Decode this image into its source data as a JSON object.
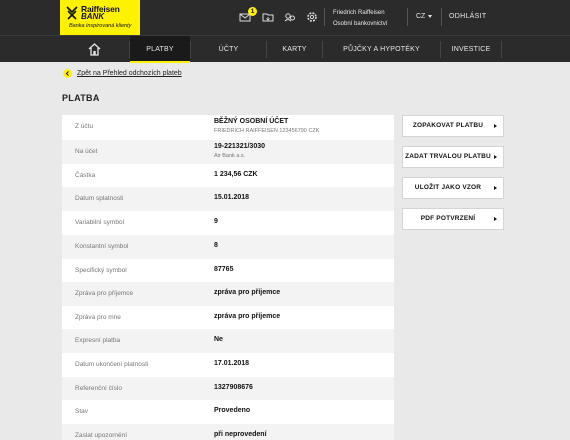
{
  "brand": {
    "name_line1": "Raiffeisen",
    "name_line2": "BANK",
    "tagline": "Banka inspirovaná klienty"
  },
  "header": {
    "notification_count": "1",
    "user_name": "Friedrich Raiffeisen",
    "user_role": "Osobní bankovnictví",
    "language": "CZ",
    "logout": "ODHLÁSIT"
  },
  "nav": {
    "items": [
      {
        "label": "PLATBY",
        "active": true
      },
      {
        "label": "ÚČTY"
      },
      {
        "label": "KARTY"
      },
      {
        "label": "PŮJČKY A HYPOTÉKY"
      },
      {
        "label": "INVESTICE"
      }
    ]
  },
  "back_link": "Zpět na Přehled odchozích plateb",
  "page_title": "PLATBA",
  "details": {
    "from_account": {
      "label": "Z účtu",
      "value": "BĚŽNÝ OSOBNÍ ÚČET",
      "sub": "FRIEDRICH RAIFFEISEN 123456790 CZK"
    },
    "to_account": {
      "label": "Na účet",
      "value": "19-221321/3030",
      "sub": "Air Bank a.s."
    },
    "amount": {
      "label": "Částka",
      "value": "1 234,56 CZK"
    },
    "due_date": {
      "label": "Datum splatnosti",
      "value": "15.01.2018"
    },
    "variable_symbol": {
      "label": "Variabilní symbol",
      "value": "9"
    },
    "constant_symbol": {
      "label": "Konstantní symbol",
      "value": "8"
    },
    "specific_symbol": {
      "label": "Specifický symbol",
      "value": "87765"
    },
    "message_recipient": {
      "label": "Zpráva pro příjemce",
      "value": "zpráva pro příjemce"
    },
    "message_me": {
      "label": "Zpráva pro mne",
      "value": "zpráva pro příjemce"
    },
    "express": {
      "label": "Expresní platba",
      "value": "Ne"
    },
    "end_date": {
      "label": "Datum ukončení platnosti",
      "value": "17.01.2018"
    },
    "reference": {
      "label": "Referenční číslo",
      "value": "1327908676"
    },
    "status": {
      "label": "Stav",
      "value": "Provedeno"
    },
    "notification": {
      "label": "Zaslat upozornění",
      "value": "při neprovedení"
    }
  },
  "actions": {
    "repeat": "ZOPAKOVAT PLATBU",
    "standing_order": "ZADAT TRVALOU PLATBU",
    "save_template": "ULOŽIT JAKO VZOR",
    "pdf": "PDF POTVRZENÍ"
  },
  "colors": {
    "brand_yellow": "#fff200",
    "header_bg": "#2b2b2b",
    "page_bg": "#e9e9e9"
  },
  "icons": [
    "mail-icon",
    "folder-icon",
    "people-icon",
    "gear-icon",
    "home-icon",
    "back-arrow-icon"
  ]
}
